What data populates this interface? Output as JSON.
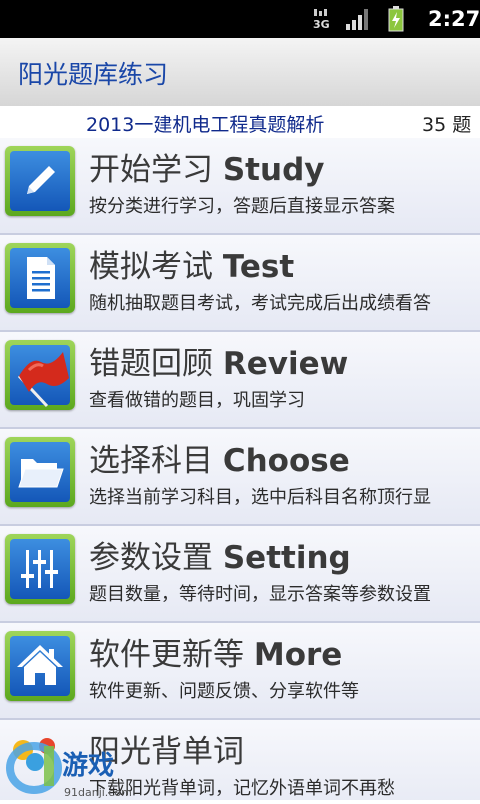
{
  "status_bar": {
    "network": "3G",
    "time": "2:27",
    "icons": [
      "3g-icon",
      "signal-icon",
      "battery-charging-icon"
    ]
  },
  "app": {
    "title": "阳光题库练习"
  },
  "exam": {
    "name": "2013一建机电工程真题解析",
    "count": "35 题"
  },
  "menu": {
    "items": [
      {
        "title_cn": "开始学习",
        "title_en": "Study",
        "desc": "按分类进行学习，答题后直接显示答案",
        "icon": "pencil-icon"
      },
      {
        "title_cn": "模拟考试",
        "title_en": "Test",
        "desc": "随机抽取题目考试，考试完成后出成绩看答",
        "icon": "document-icon"
      },
      {
        "title_cn": "错题回顾",
        "title_en": "Review",
        "desc": "查看做错的题目，巩固学习",
        "icon": "red-flag-icon"
      },
      {
        "title_cn": "选择科目",
        "title_en": "Choose",
        "desc": "选择当前学习科目，选中后科目名称顶行显",
        "icon": "folder-icon"
      },
      {
        "title_cn": "参数设置",
        "title_en": "Setting",
        "desc": "题目数量，等待时间，显示答案等参数设置",
        "icon": "sliders-icon"
      },
      {
        "title_cn": "软件更新等",
        "title_en": "More",
        "desc": "软件更新、问题反馈、分享软件等",
        "icon": "home-icon"
      },
      {
        "title_cn": "阳光背单词",
        "title_en": "",
        "desc": "下载阳光背单词，记忆外语单词不再愁",
        "icon": "vocab-app-icon"
      }
    ]
  },
  "watermark": {
    "text": "游戏",
    "site": "91danji.com"
  },
  "colors": {
    "status_bar_bg": "#000000",
    "title_text": "#1a47a8",
    "exam_text": "#102a8c",
    "icon_frame_green": "#7cc23a",
    "icon_inner_blue": "#1f6fcf"
  }
}
